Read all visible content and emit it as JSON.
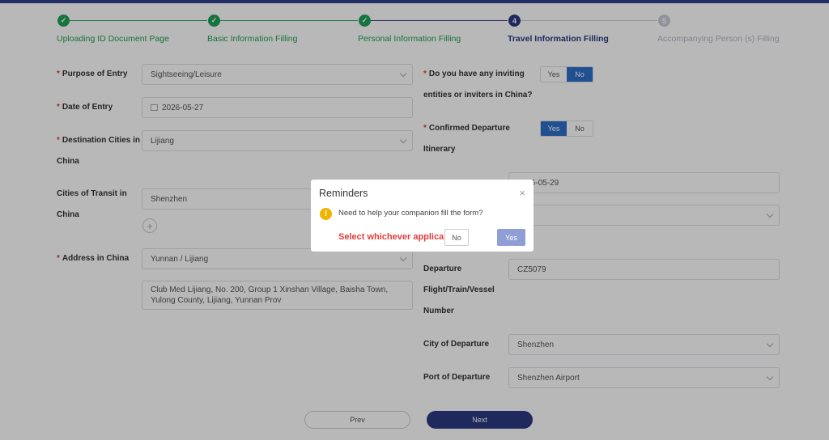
{
  "steps": [
    {
      "label": "Uploading ID Document Page",
      "state": "done",
      "number": ""
    },
    {
      "label": "Basic Information Filling",
      "state": "done",
      "number": ""
    },
    {
      "label": "Personal Information Filling",
      "state": "done",
      "number": ""
    },
    {
      "label": "Travel Information Filling",
      "state": "active",
      "number": "4"
    },
    {
      "label": "Accompanying Person (s) Filling",
      "state": "todo",
      "number": "5"
    }
  ],
  "form": {
    "purpose_label": "Purpose of Entry",
    "purpose_value": "Sightseeing/Leisure",
    "date_label": "Date of Entry",
    "date_value": "2026-05-27",
    "dest_label_1": "Destination Cities in",
    "dest_label_2": "China",
    "dest_value": "Lijiang",
    "transit_label_1": "Cities of Transit in",
    "transit_label_2": "China",
    "transit_value": "Shenzhen",
    "address_label": "Address in China",
    "address_value": "Yunnan / Lijiang",
    "address_detail": "Club Med Lijiang, No. 200, Group 1 Xinshan Village, Baisha Town, Yulong County, Lijiang, Yunnan Prov",
    "inviting_label_1": "Do you have any inviting",
    "inviting_label_2": "entities or inviters in China?",
    "inviting_yes": "Yes",
    "inviting_no": "No",
    "itinerary_label_1": "Confirmed Departure",
    "itinerary_label_2": "Itinerary",
    "itinerary_yes": "Yes",
    "itinerary_no": "No",
    "departure_date_value": "2026-05-29",
    "hidden_select_value": "t",
    "flight_label_1": "Departure",
    "flight_label_2": "Flight/Train/Vessel",
    "flight_label_3": "Number",
    "flight_value": "CZ5079",
    "city_dep_label": "City of Departure",
    "city_dep_value": "Shenzhen",
    "port_dep_label": "Port of Departure",
    "port_dep_value": "Shenzhen Airport",
    "required_mark": "*"
  },
  "buttons": {
    "prev": "Prev",
    "next": "Next",
    "add": "+"
  },
  "modal": {
    "title": "Reminders",
    "close": "×",
    "icon": "!",
    "message": "Need to help your companion fill the form?",
    "annotation": "Select whichever applicable",
    "no": "No",
    "yes": "Yes"
  },
  "colors": {
    "done": "#1fa157",
    "active": "#2b3a82",
    "todo": "#c9ccd6",
    "selected": "#2f6fc9",
    "annotation": "#e23b3b"
  }
}
